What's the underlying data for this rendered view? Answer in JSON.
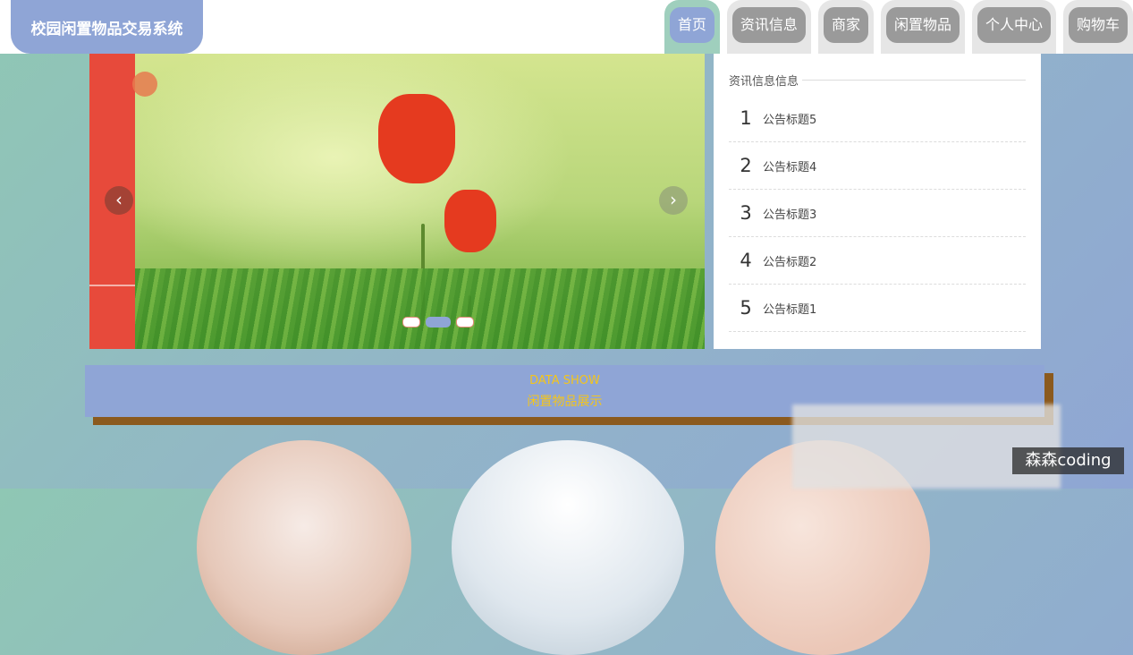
{
  "app": {
    "title": "校园闲置物品交易系统"
  },
  "nav": {
    "items": [
      {
        "label": "首页"
      },
      {
        "label": "资讯信息"
      },
      {
        "label": "商家"
      },
      {
        "label": "闲置物品"
      },
      {
        "label": "个人中心"
      },
      {
        "label": "购物车"
      }
    ],
    "active": "首页"
  },
  "banner": {
    "prev_icon": "chevron-left-icon",
    "next_icon": "chevron-right-icon",
    "slides": 3,
    "active_slide": 2
  },
  "news": {
    "title": "资讯信息信息",
    "items": [
      {
        "num": "1",
        "title": "公告标题5"
      },
      {
        "num": "2",
        "title": "公告标题4"
      },
      {
        "num": "3",
        "title": "公告标题3"
      },
      {
        "num": "4",
        "title": "公告标题2"
      },
      {
        "num": "5",
        "title": "公告标题1"
      }
    ]
  },
  "section": {
    "en": "DATA SHOW",
    "cn": "闲置物品展示"
  },
  "watermark": "森森coding",
  "colors": {
    "accent": "#8fa5d6",
    "nav_inactive": "#9a9a9a",
    "section_text": "#f4c51b",
    "banner_side": "#e74a3b"
  }
}
